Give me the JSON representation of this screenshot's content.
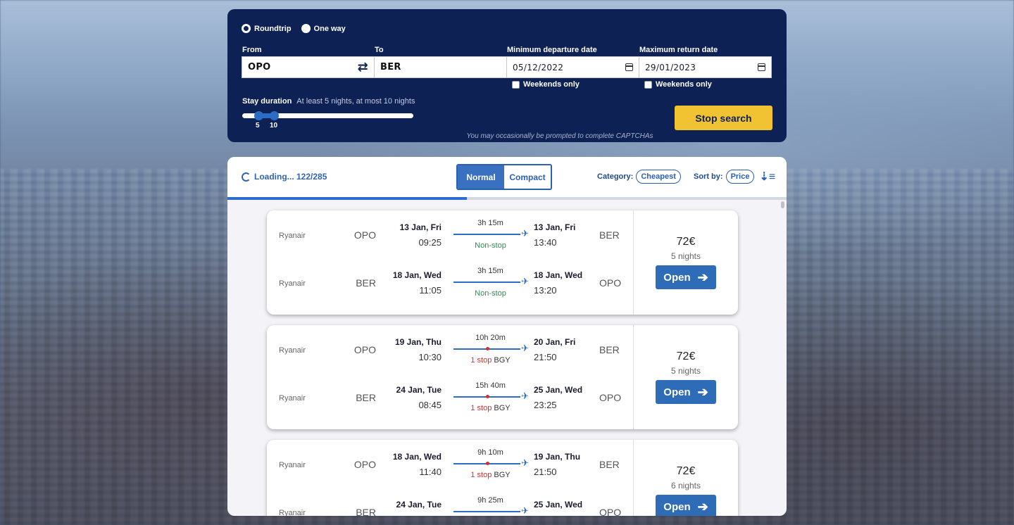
{
  "trip_type": {
    "options": [
      "Roundtrip",
      "One way"
    ],
    "selected": "Roundtrip"
  },
  "search": {
    "from_label": "From",
    "from_value": "OPO",
    "to_label": "To",
    "to_value": "BER",
    "min_departure_label": "Minimum departure date",
    "min_departure_value": "05/12/2022",
    "max_return_label": "Maximum return date",
    "max_return_value": "29/01/2023",
    "weekends_only_label": "Weekends only",
    "stay_duration_label": "Stay duration",
    "stay_duration_desc": "At least 5 nights, at most 10 nights",
    "stay_min": "5",
    "stay_max": "10",
    "captcha_note": "You may occasionally be prompted to complete CAPTCHAs",
    "stop_button": "Stop search"
  },
  "results": {
    "loading_text": "Loading... 122/285",
    "progress_fraction": 0.4281,
    "view_normal": "Normal",
    "view_compact": "Compact",
    "category_label": "Category:",
    "category_value": "Cheapest",
    "sort_label": "Sort by:",
    "sort_value": "Price",
    "open_label": "Open",
    "cards": [
      {
        "price": "72€",
        "nights": "5 nights",
        "legs": [
          {
            "airline": "Ryanair",
            "from": "OPO",
            "dep_date": "13 Jan, Fri",
            "dep_time": "09:25",
            "duration": "3h 15m",
            "stops_count": "",
            "stops_text": "Non-stop",
            "via": "",
            "arr_date": "13 Jan, Fri",
            "arr_time": "13:40",
            "to": "BER"
          },
          {
            "airline": "Ryanair",
            "from": "BER",
            "dep_date": "18 Jan, Wed",
            "dep_time": "11:05",
            "duration": "3h 15m",
            "stops_count": "",
            "stops_text": "Non-stop",
            "via": "",
            "arr_date": "18 Jan, Wed",
            "arr_time": "13:20",
            "to": "OPO"
          }
        ]
      },
      {
        "price": "72€",
        "nights": "5 nights",
        "legs": [
          {
            "airline": "Ryanair",
            "from": "OPO",
            "dep_date": "19 Jan, Thu",
            "dep_time": "10:30",
            "duration": "10h 20m",
            "stops_count": "1 stop",
            "stops_text": "",
            "via": "BGY",
            "arr_date": "20 Jan, Fri",
            "arr_time": "21:50",
            "to": "BER"
          },
          {
            "airline": "Ryanair",
            "from": "BER",
            "dep_date": "24 Jan, Tue",
            "dep_time": "08:45",
            "duration": "15h 40m",
            "stops_count": "1 stop",
            "stops_text": "",
            "via": "BGY",
            "arr_date": "25 Jan, Wed",
            "arr_time": "23:25",
            "to": "OPO"
          }
        ]
      },
      {
        "price": "72€",
        "nights": "6 nights",
        "legs": [
          {
            "airline": "Ryanair",
            "from": "OPO",
            "dep_date": "18 Jan, Wed",
            "dep_time": "11:40",
            "duration": "9h 10m",
            "stops_count": "1 stop",
            "stops_text": "",
            "via": "BGY",
            "arr_date": "19 Jan, Thu",
            "arr_time": "21:50",
            "to": "BER"
          },
          {
            "airline": "Ryanair",
            "from": "BER",
            "dep_date": "24 Jan, Tue",
            "dep_time": "",
            "duration": "9h 25m",
            "stops_count": "",
            "stops_text": "",
            "via": "",
            "arr_date": "25 Jan, Wed",
            "arr_time": "",
            "to": "OPO"
          }
        ]
      }
    ]
  }
}
